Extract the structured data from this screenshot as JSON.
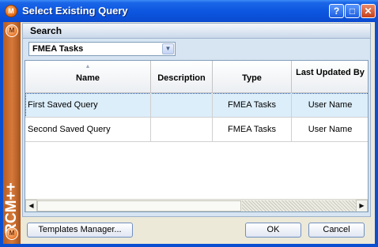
{
  "window": {
    "title": "Select Existing Query",
    "logo_glyph": "M",
    "controls": {
      "help": "?",
      "maximize": "□",
      "close": "✕"
    }
  },
  "sidebar": {
    "brand": "RCM++",
    "logo_glyph": "M"
  },
  "search": {
    "header": "Search",
    "type_selected": "FMEA Tasks",
    "dropdown_glyph": "▼"
  },
  "table": {
    "sort_indicator": "▲",
    "columns": [
      "Name",
      "Description",
      "Type",
      "Last Updated By"
    ],
    "rows": [
      {
        "name": "First Saved Query",
        "description": "",
        "type": "FMEA Tasks",
        "last_updated_by": "User Name",
        "selected": true
      },
      {
        "name": "Second Saved Query",
        "description": "",
        "type": "FMEA Tasks",
        "last_updated_by": "User Name",
        "selected": false
      }
    ]
  },
  "scroll": {
    "left_glyph": "◀",
    "right_glyph": "▶"
  },
  "buttons": {
    "templates_manager": "Templates Manager...",
    "ok": "OK",
    "cancel": "Cancel"
  },
  "colors": {
    "titlebar": "#0c55df",
    "sidebar": "#c8692c",
    "panel": "#d7e4f2",
    "selected_row": "#dceefa"
  },
  "icons": [
    "help-icon",
    "maximize-icon",
    "close-icon",
    "app-logo-icon",
    "chevron-down-icon",
    "sort-up-icon",
    "scroll-left-icon",
    "scroll-right-icon"
  ]
}
